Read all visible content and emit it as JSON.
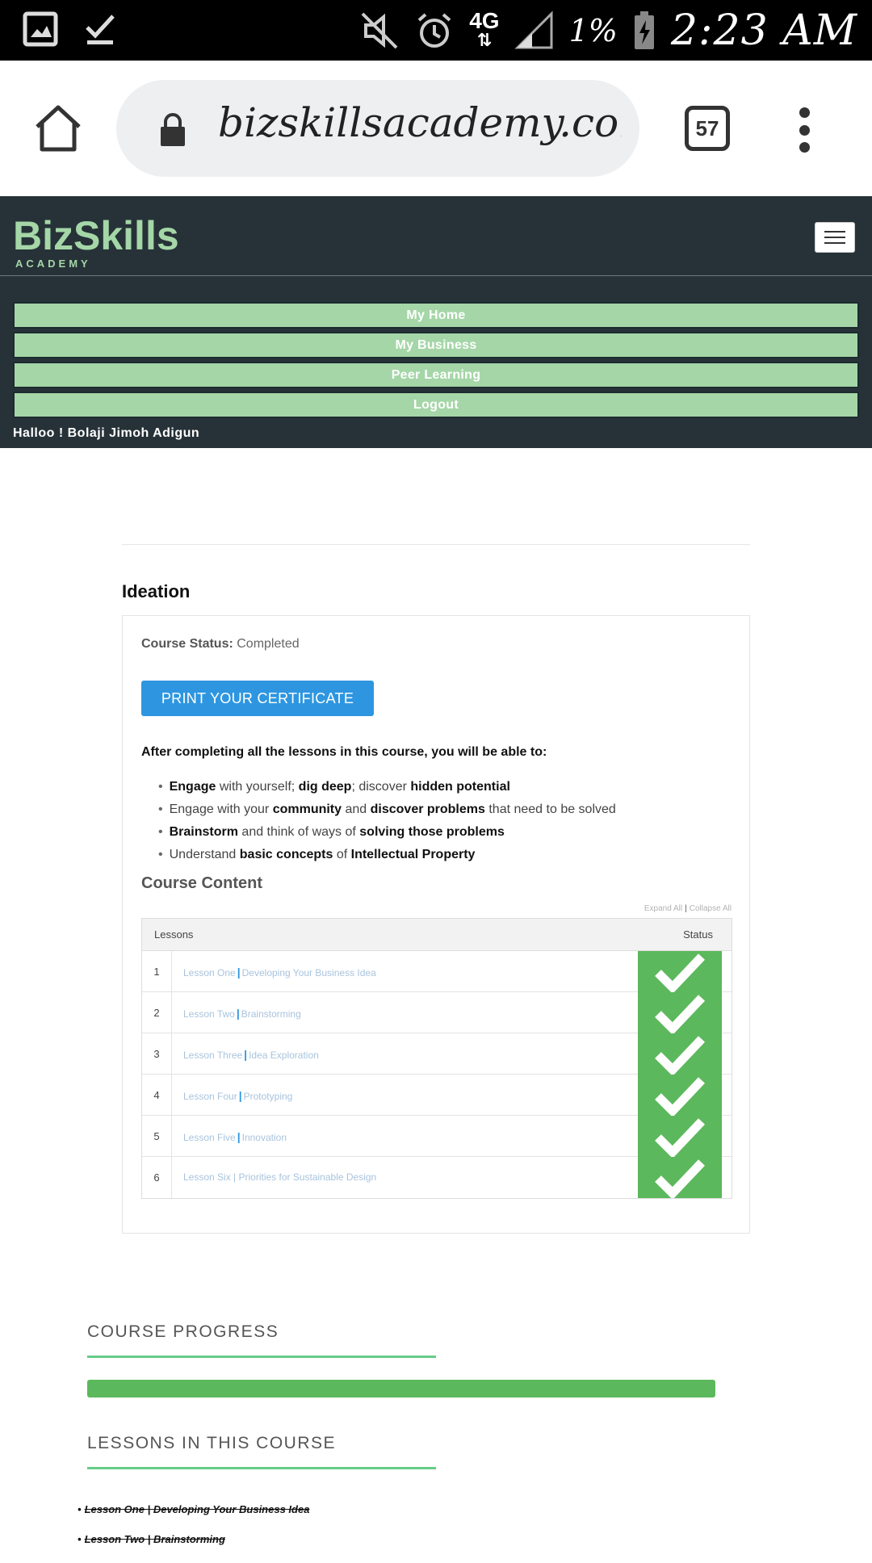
{
  "status_bar": {
    "battery_percent": "1%",
    "network": "4G",
    "time": "2:23 AM",
    "icons": [
      "gallery-icon",
      "download-done-icon",
      "mute-icon",
      "alarm-icon",
      "network-4g-icon",
      "signal-icon",
      "battery-charging-icon"
    ]
  },
  "browser": {
    "url": "bizskillsacademy.com/courses/ideation",
    "tab_count": "57"
  },
  "site": {
    "brand": "BizSkills",
    "brand_sub": "ACADEMY",
    "nav": [
      "My Home",
      "My Business",
      "Peer Learning",
      "Logout"
    ],
    "greeting": "Halloo ! Bolaji Jimoh Adigun"
  },
  "course": {
    "title": "Ideation",
    "status_label": "Course Status:",
    "status_value": "Completed",
    "certificate_button": "PRINT YOUR CERTIFICATE",
    "intro": "After completing all the lessons in this course, you will be able to:",
    "content_title": "Course Content",
    "expand_all": "Expand All",
    "collapse_all": "Collapse All",
    "table_headers": {
      "lessons": "Lessons",
      "status": "Status"
    },
    "lessons": [
      {
        "num": "1",
        "lead": "Lesson One",
        "sep": "|",
        "topic": "Developing Your Business Idea",
        "status": "completed"
      },
      {
        "num": "2",
        "lead": "Lesson Two",
        "sep": "|",
        "topic": "Brainstorming",
        "status": "completed"
      },
      {
        "num": "3",
        "lead": "Lesson Three",
        "sep": "|",
        "topic": "Idea Exploration",
        "status": "completed"
      },
      {
        "num": "4",
        "lead": "Lesson Four",
        "sep": "|",
        "topic": "Prototyping",
        "status": "completed"
      },
      {
        "num": "5",
        "lead": "Lesson Five",
        "sep": "|",
        "topic": "Innovation",
        "status": "completed"
      },
      {
        "num": "6",
        "lead": "Lesson Six | Priorities for Sustainable Design",
        "sep": "",
        "topic": "",
        "status": "completed"
      }
    ]
  },
  "outcomes": [
    [
      {
        "t": "Engage",
        "b": true
      },
      {
        "t": " with yourself; ",
        "b": false
      },
      {
        "t": "dig deep",
        "b": true
      },
      {
        "t": "; discover ",
        "b": false
      },
      {
        "t": "hidden potential",
        "b": true
      }
    ],
    [
      {
        "t": "Engage with your ",
        "b": false
      },
      {
        "t": "community",
        "b": true
      },
      {
        "t": " and ",
        "b": false
      },
      {
        "t": "discover problems",
        "b": true
      },
      {
        "t": " that need to be solved",
        "b": false
      }
    ],
    [
      {
        "t": "Brainstorm",
        "b": true
      },
      {
        "t": " and think of ways of ",
        "b": false
      },
      {
        "t": "solving those problems",
        "b": true
      }
    ],
    [
      {
        "t": "Understand ",
        "b": false
      },
      {
        "t": "basic concepts",
        "b": true
      },
      {
        "t": " of ",
        "b": false
      },
      {
        "t": "Intellectual Property",
        "b": true
      }
    ]
  ],
  "progress": {
    "title": "COURSE PROGRESS",
    "percent": 100,
    "color": "#5cb85c"
  },
  "lessons_section": {
    "title": "LESSONS IN THIS COURSE",
    "items": [
      "Lesson One | Developing Your Business Idea",
      "Lesson Two | Brainstorming"
    ]
  },
  "colors": {
    "header_bg": "#263238",
    "nav_green": "#a5d6a7",
    "primary_blue": "#2e96e0",
    "success_green": "#5cb85c"
  }
}
